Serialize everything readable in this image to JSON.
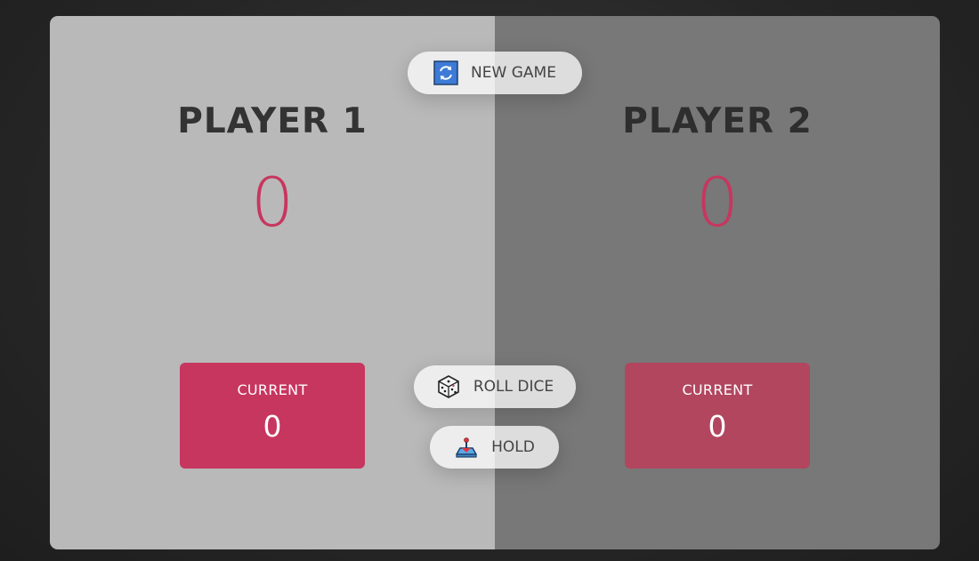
{
  "buttons": {
    "new_game": "NEW GAME",
    "roll_dice": "ROLL DICE",
    "hold": "HOLD"
  },
  "players": [
    {
      "name": "PLAYER 1",
      "score": "0",
      "current_label": "CURRENT",
      "current_score": "0",
      "active": true
    },
    {
      "name": "PLAYER 2",
      "score": "0",
      "current_label": "CURRENT",
      "current_score": "0",
      "active": false
    }
  ],
  "icons": {
    "new_game": "refresh-icon",
    "roll_dice": "dice-icon",
    "hold": "joystick-icon"
  },
  "colors": {
    "accent": "#c7365f",
    "active_panel": "#b9b9b9",
    "inactive_panel": "#787878"
  }
}
